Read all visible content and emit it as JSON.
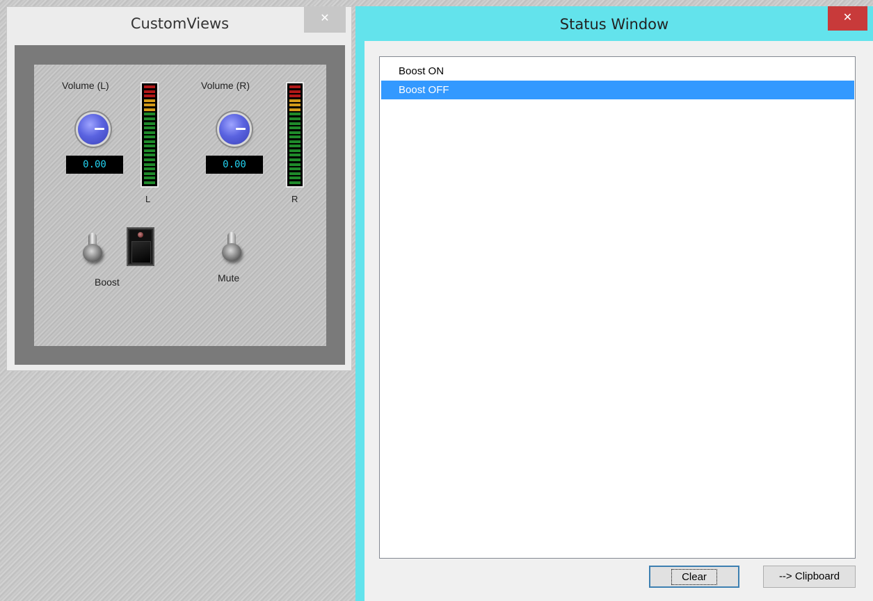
{
  "custom_views": {
    "title": "CustomViews",
    "close_glyph": "✕",
    "left_channel": {
      "volume_label": "Volume (L)",
      "readout": "0.00",
      "meter_label": "L"
    },
    "right_channel": {
      "volume_label": "Volume (R)",
      "readout": "0.00",
      "meter_label": "R"
    },
    "boost_label": "Boost",
    "mute_label": "Mute"
  },
  "status_window": {
    "title": "Status Window",
    "close_glyph": "✕",
    "accent_color": "#63e3ec",
    "selection_color": "#3399ff",
    "items": [
      {
        "label": "Boost ON",
        "selected": false
      },
      {
        "label": "Boost OFF",
        "selected": true
      }
    ],
    "clear_label": "Clear",
    "clipboard_label": "--> Clipboard"
  }
}
